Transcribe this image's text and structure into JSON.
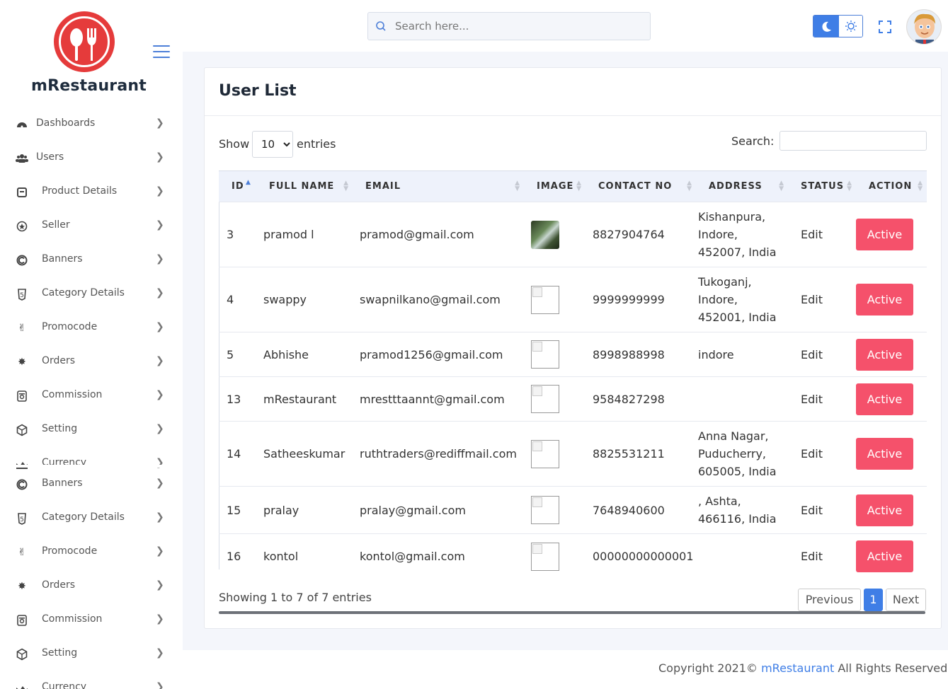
{
  "brand": {
    "name": "mRestaurant"
  },
  "header": {
    "search_placeholder": "Search here..."
  },
  "sidebar": {
    "items": [
      {
        "label": "Dashboards",
        "icon": "dashboard-icon"
      },
      {
        "label": "Users",
        "icon": "users-icon"
      },
      {
        "label": "Product Details",
        "icon": "product-icon"
      },
      {
        "label": "Seller",
        "icon": "seller-icon"
      },
      {
        "label": "Banners",
        "icon": "banner-icon"
      },
      {
        "label": "Category Details",
        "icon": "category-icon"
      },
      {
        "label": "Promocode",
        "icon": "promocode-icon"
      },
      {
        "label": "Orders",
        "icon": "orders-icon"
      },
      {
        "label": "Commission",
        "icon": "commission-icon"
      },
      {
        "label": "Setting",
        "icon": "setting-icon"
      },
      {
        "label": "Currency",
        "icon": "currency-icon"
      }
    ],
    "items_repeat": [
      {
        "label": "Banners",
        "icon": "banner-icon"
      },
      {
        "label": "Category Details",
        "icon": "category-icon"
      },
      {
        "label": "Promocode",
        "icon": "promocode-icon"
      },
      {
        "label": "Orders",
        "icon": "orders-icon"
      },
      {
        "label": "Commission",
        "icon": "commission-icon"
      },
      {
        "label": "Setting",
        "icon": "setting-icon"
      },
      {
        "label": "Currency",
        "icon": "currency-icon"
      }
    ]
  },
  "card": {
    "title": "User List",
    "show_label": "Show",
    "entries_label": "entries",
    "entries_value": "10",
    "search_label": "Search:"
  },
  "table": {
    "columns": [
      "ID",
      "FULL NAME",
      "EMAIL",
      "IMAGE",
      "CONTACT NO",
      "ADDRESS",
      "STATUS",
      "ACTION"
    ],
    "rows": [
      {
        "id": "3",
        "name": "pramod l",
        "email": "pramod@gmail.com",
        "image": "photo",
        "contact": "8827904764",
        "address": [
          "Kishanpura,",
          "Indore,",
          "452007, India"
        ],
        "status": "Edit",
        "action": "Active"
      },
      {
        "id": "4",
        "name": "swappy",
        "email": "swapnilkano@gmail.com",
        "image": "broken",
        "contact": "9999999999",
        "address": [
          "Tukoganj,",
          "Indore,",
          "452001, India"
        ],
        "status": "Edit",
        "action": "Active"
      },
      {
        "id": "5",
        "name": "Abhishe",
        "email": "pramod1256@gmail.com",
        "image": "broken",
        "contact": "8998988998",
        "address": [
          "indore"
        ],
        "status": "Edit",
        "action": "Active"
      },
      {
        "id": "13",
        "name": "mRestaurant",
        "email": "mrestttaannt@gmail.com",
        "image": "broken",
        "contact": "9584827298",
        "address": [],
        "status": "Edit",
        "action": "Active"
      },
      {
        "id": "14",
        "name": "Satheeskumar",
        "email": "ruthtraders@rediffmail.com",
        "image": "broken",
        "contact": "8825531211",
        "address": [
          "Anna Nagar,",
          "Puducherry,",
          "605005, India"
        ],
        "status": "Edit",
        "action": "Active"
      },
      {
        "id": "15",
        "name": "pralay",
        "email": "pralay@gmail.com",
        "image": "broken",
        "contact": "7648940600",
        "address": [
          ", Ashta,",
          "466116, India"
        ],
        "status": "Edit",
        "action": "Active"
      },
      {
        "id": "16",
        "name": "kontol",
        "email": "kontol@gmail.com",
        "image": "broken",
        "contact": "00000000000001",
        "address": [],
        "status": "Edit",
        "action": "Active"
      }
    ]
  },
  "pagination": {
    "info": "Showing 1 to 7 of 7 entries",
    "previous": "Previous",
    "current": "1",
    "next": "Next"
  },
  "footer": {
    "prefix": "Copyright 2021© ",
    "brand": "mRestaurant",
    "suffix": " All Rights Reserved."
  },
  "colors": {
    "brand_red": "#e53b3b",
    "accent_blue": "#3f7ee6",
    "active_button": "#f5516b"
  }
}
